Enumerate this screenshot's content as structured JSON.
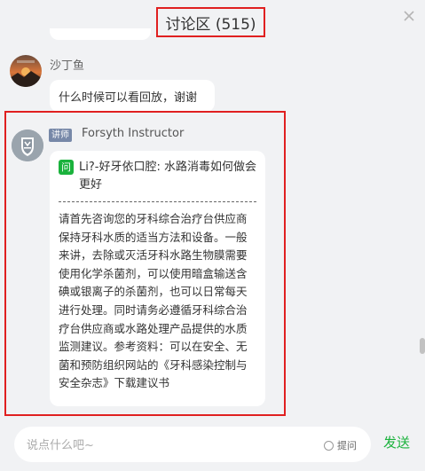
{
  "header": {
    "title": "讨论区 (515)",
    "close_icon": "close-icon"
  },
  "messages": [
    {
      "user": "沙丁鱼",
      "text": "什么时候可以看回放，谢谢"
    },
    {
      "role_badge": "讲师",
      "user": "Forsyth Instructor",
      "question_badge": "问",
      "question": "Li?-好牙依口腔: 水路消毒如何做会更好",
      "answer": "请首先咨询您的牙科综合治疗台供应商保持牙科水质的适当方法和设备。一般来讲，去除或灭活牙科水路生物膜需要使用化学杀菌剂，可以使用暗盒输送含碘或银离子的杀菌剂，也可以日常每天进行处理。同时请务必遵循牙科综合治疗台供应商或水路处理产品提供的水质监测建议。参考资料：可以在安全、无菌和预防组织网站的《牙科感染控制与安全杂志》下载建议书"
    }
  ],
  "input": {
    "placeholder": "说点什么吧~",
    "value": "",
    "question_toggle_label": "提问",
    "send_label": "发送"
  },
  "colors": {
    "accent_green": "#1ab23c",
    "highlight_red": "#e02020",
    "badge_blue": "#7788a8",
    "panel_bg": "#f1f2f4"
  }
}
